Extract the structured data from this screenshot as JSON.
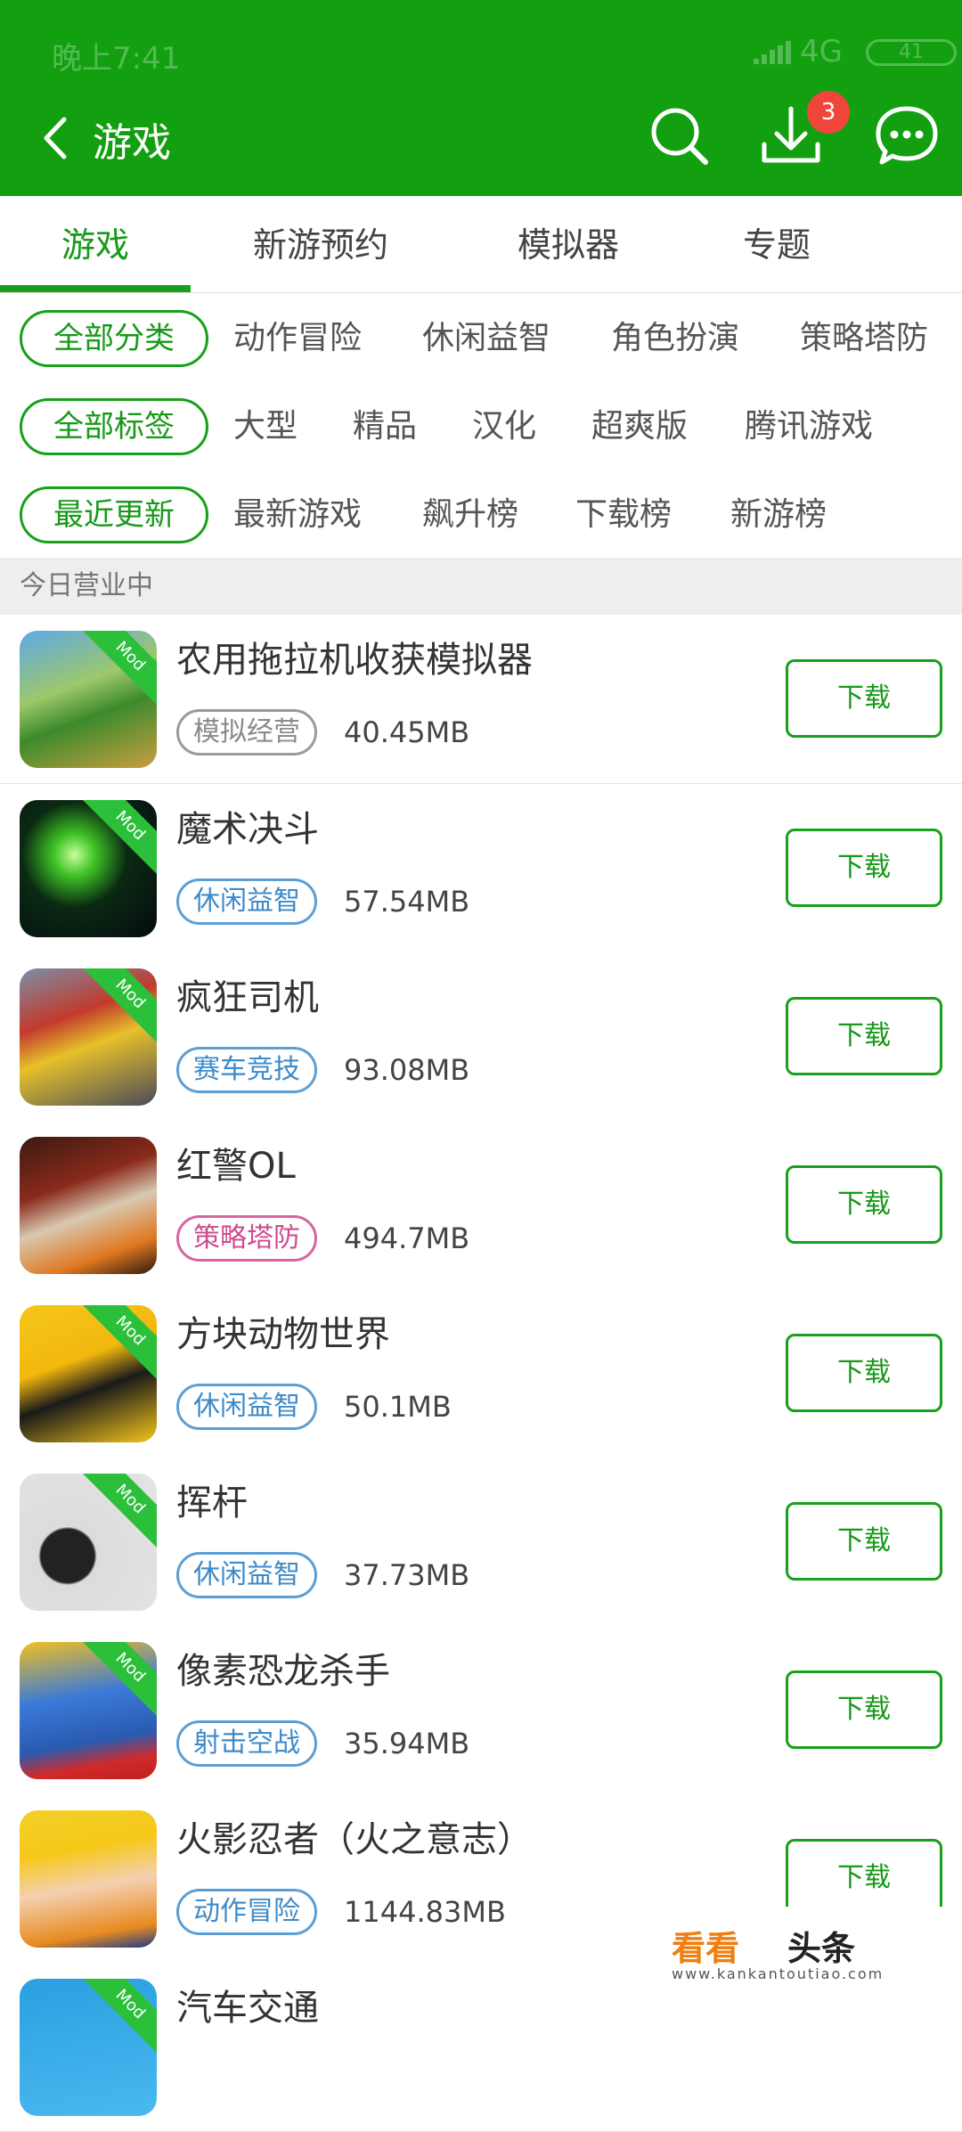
{
  "status_bar": {
    "time": "晚上7:41",
    "network": "4G",
    "battery": "41"
  },
  "header": {
    "title": "游戏",
    "download_badge": "3",
    "icons": [
      "back-arrow-icon",
      "search-icon",
      "download-icon",
      "chat-icon"
    ]
  },
  "tabs": [
    {
      "label": "游戏",
      "active": true
    },
    {
      "label": "新游预约"
    },
    {
      "label": "模拟器"
    },
    {
      "label": "专题"
    }
  ],
  "filters": {
    "category": {
      "selected": "全部分类",
      "options": [
        "动作冒险",
        "休闲益智",
        "角色扮演",
        "策略塔防"
      ]
    },
    "tag": {
      "selected": "全部标签",
      "options": [
        "大型",
        "精品",
        "汉化",
        "超爽版",
        "腾讯游戏"
      ]
    },
    "sort": {
      "selected": "最近更新",
      "options": [
        "最新游戏",
        "飙升榜",
        "下载榜",
        "新游榜"
      ]
    }
  },
  "section_title": "今日营业中",
  "games": [
    {
      "name": "农用拖拉机收获模拟器",
      "tag": "模拟经营",
      "size": "40.45MB",
      "badge": "Mod",
      "button": "下载"
    },
    {
      "name": "魔术决斗",
      "tag": "休闲益智",
      "size": "57.54MB",
      "badge": "Mod",
      "button": "下载"
    },
    {
      "name": "疯狂司机",
      "tag": "赛车竞技",
      "size": "93.08MB",
      "badge": "Mod",
      "button": "下载"
    },
    {
      "name": "红警OL",
      "tag": "策略塔防",
      "size": "494.7MB",
      "badge": "",
      "button": "下载"
    },
    {
      "name": "方块动物世界",
      "tag": "休闲益智",
      "size": "50.1MB",
      "badge": "Mod",
      "button": "下载"
    },
    {
      "name": "挥杆",
      "tag": "休闲益智",
      "size": "37.73MB",
      "badge": "Mod",
      "button": "下载"
    },
    {
      "name": "像素恐龙杀手",
      "tag": "射击空战",
      "size": "35.94MB",
      "badge": "Mod",
      "button": "下载"
    },
    {
      "name": "火影忍者（火之意志）",
      "tag": "动作冒险",
      "size": "1144.83MB",
      "badge": "",
      "button": "下载"
    },
    {
      "name": "汽车交通",
      "tag": "",
      "size": "",
      "badge": "Mod",
      "button": ""
    }
  ],
  "watermark": {
    "brand": "看看",
    "suffix": "头条",
    "url": "www.kankantoutiao.com"
  },
  "colors": {
    "primary": "#13a010",
    "accent_green": "#17991a",
    "badge_red": "#f0453a"
  }
}
